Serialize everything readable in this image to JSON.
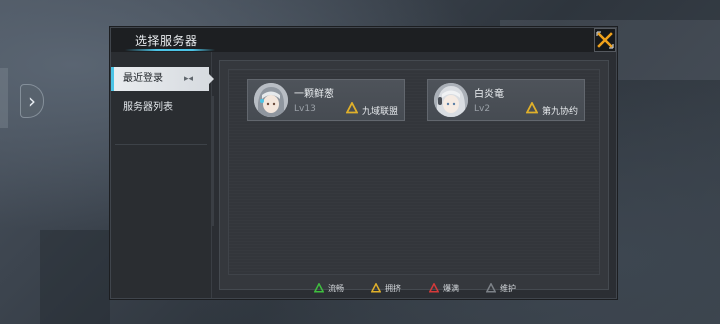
{
  "dialog": {
    "title": "选择服务器"
  },
  "sidebar": {
    "items": [
      {
        "label": "最近登录",
        "active": true
      },
      {
        "label": "服务器列表",
        "active": false
      }
    ]
  },
  "servers": [
    {
      "name": "一颗鲜葱",
      "level": "Lv13",
      "server": "九域联盟",
      "status": "busy",
      "status_color": "#e0b02a"
    },
    {
      "name": "白炎竜",
      "level": "Lv2",
      "server": "第九协约",
      "status": "busy",
      "status_color": "#e0b02a"
    }
  ],
  "legend": [
    {
      "label": "流畅",
      "color": "#3fbf3f"
    },
    {
      "label": "拥挤",
      "color": "#e0b02a"
    },
    {
      "label": "爆满",
      "color": "#d63a3a"
    },
    {
      "label": "维护",
      "color": "#7d8288"
    }
  ],
  "colors": {
    "accent": "#4cc4e6",
    "close_icon": "#f0a21c"
  }
}
